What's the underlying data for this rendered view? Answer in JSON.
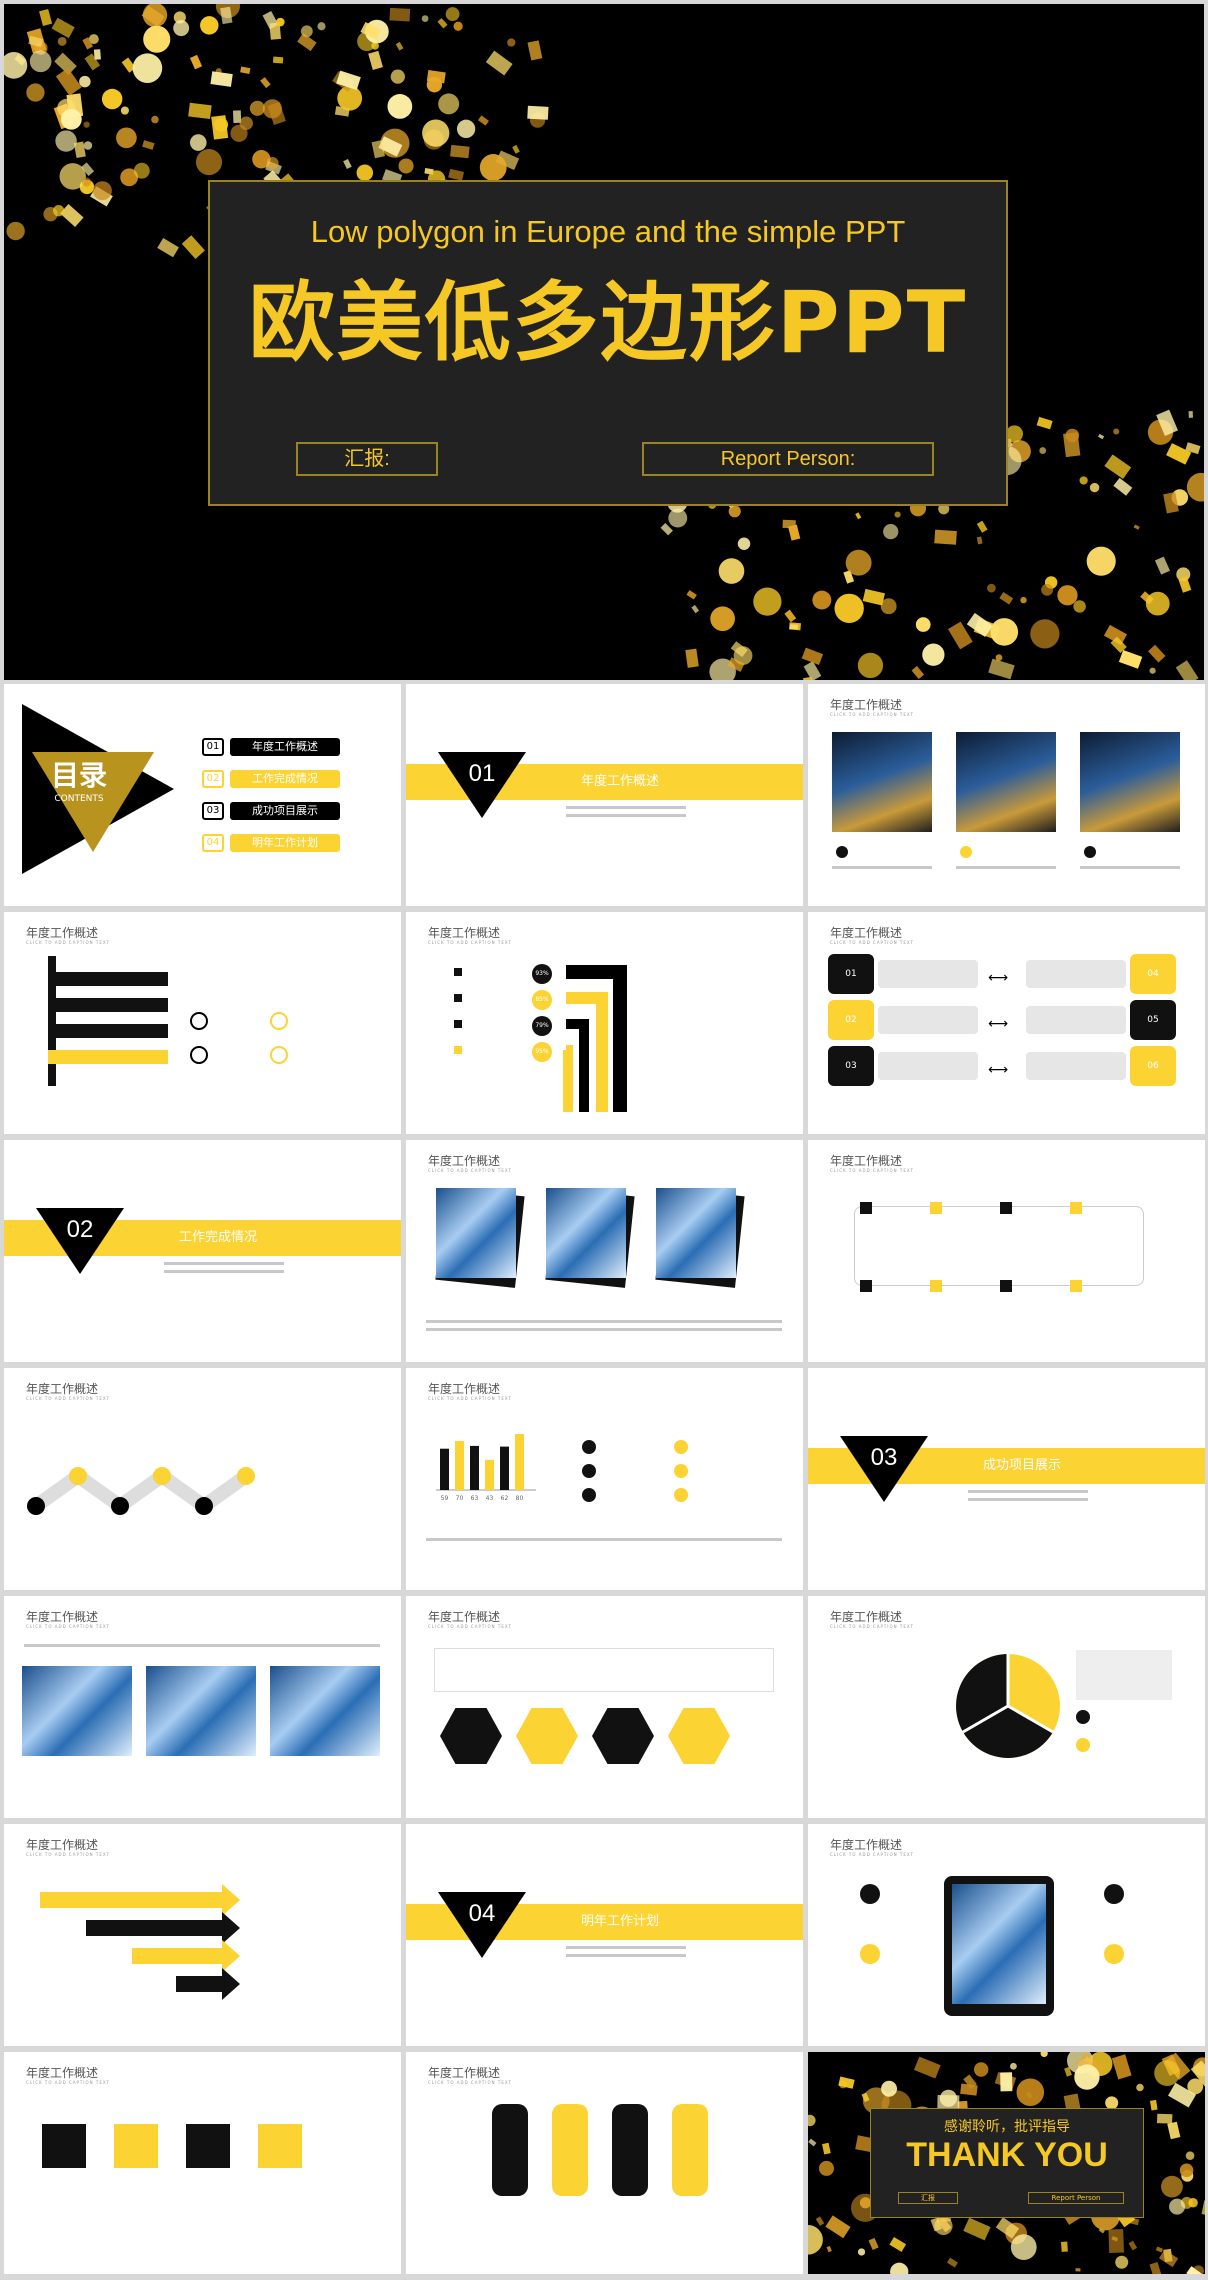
{
  "hero": {
    "title_en": "Low polygon in Europe and the simple PPT",
    "title_cn": "欧美低多边形PPT",
    "btn_left": "汇报:",
    "btn_right": "Report Person:"
  },
  "toc": {
    "title": "目录",
    "subtitle": "CONTENTS",
    "items": [
      {
        "num": "01",
        "label": "年度工作概述"
      },
      {
        "num": "02",
        "label": "工作完成情况"
      },
      {
        "num": "03",
        "label": "成功项目展示"
      },
      {
        "num": "04",
        "label": "明年工作计划"
      }
    ]
  },
  "sections": [
    {
      "num": "01",
      "label": "年度工作概述"
    },
    {
      "num": "02",
      "label": "工作完成情况"
    },
    {
      "num": "03",
      "label": "成功项目展示"
    },
    {
      "num": "04",
      "label": "明年工作计划"
    }
  ],
  "slide_title": "年度工作概述",
  "slide_sub": "CLICK TO ADD CAPTION TEXT",
  "percents": [
    "93%",
    "85%",
    "79%",
    "95%"
  ],
  "numbered": [
    "01",
    "02",
    "03",
    "04",
    "05",
    "06"
  ],
  "bar_labels": [
    "59",
    "70",
    "63",
    "43",
    "62",
    "80"
  ],
  "chart_data": {
    "type": "bar",
    "categories": [
      "59",
      "70",
      "63",
      "43",
      "62",
      "80"
    ],
    "series": [
      {
        "values": [
          59,
          70,
          63,
          43,
          62,
          80
        ]
      }
    ]
  },
  "thanks": {
    "cn": "感谢聆听，批评指导",
    "en": "THANK YOU",
    "left": "汇报",
    "right": "Report Person"
  }
}
